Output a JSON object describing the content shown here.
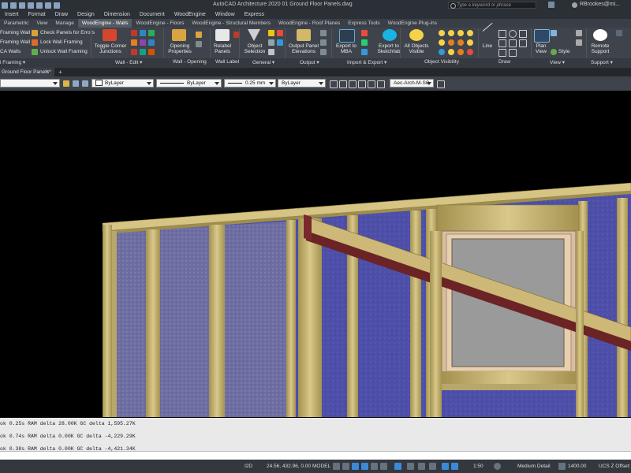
{
  "titlebar": {
    "app_title": "AutoCAD Architecture 2020   01 Ground Floor Panels.dwg",
    "search_placeholder": "Type a keyword or phrase",
    "user": "RBrookes@mi..."
  },
  "menu": [
    "Insert",
    "Format",
    "Draw",
    "Design",
    "Dimension",
    "Document",
    "WoodEngine",
    "Window",
    "Express"
  ],
  "ribbon_tabs": [
    {
      "label": "Parametric",
      "active": false
    },
    {
      "label": "View",
      "active": false
    },
    {
      "label": "Manage",
      "active": false
    },
    {
      "label": "WoodEngine - Walls",
      "active": true
    },
    {
      "label": "WoodEngine - Floors",
      "active": false
    },
    {
      "label": "WoodEngine - Structural Members",
      "active": false
    },
    {
      "label": "WoodEngine - Roof Planes",
      "active": false
    },
    {
      "label": "Express Tools",
      "active": false
    },
    {
      "label": "WoodEngine Plug-ins",
      "active": false
    }
  ],
  "ribbon": {
    "framing_wall": "Framing Wall",
    "framing_wall_2": "Framing Wall",
    "ca_walls": "CA Walls",
    "wall_framing_dd": "l Framing",
    "check_panels": "Check Panels for Errors",
    "lock_wall": "Lock Wall Framing",
    "unlock_wall": "Unlock Wall Framing",
    "toggle_corner_1": "Toggle Corner",
    "toggle_corner_2": "Junctions",
    "opening_1": "Opening",
    "opening_2": "Properties",
    "relabel_1": "Relabel",
    "relabel_2": "Panels",
    "object_sel_1": "Object",
    "object_sel_2": "Selection",
    "output_panel_1": "Output Panel",
    "output_panel_2": "Elevations",
    "export_mba_1": "Export to",
    "export_mba_2": "MBA",
    "export_sf_1": "Export to",
    "export_sf_2": "Sketchfab",
    "all_objects_1": "All Objects",
    "all_objects_2": "Visible",
    "line": "Line",
    "plan_view_1": "Plan",
    "plan_view_2": "View",
    "style": "Style",
    "remote_1": "Remote",
    "remote_2": "Support"
  },
  "ribbon_groups": {
    "wall_edit": "Wall - Edit",
    "wall_opening": "Wall - Opening",
    "wall_label": "Wall Label",
    "general": "General",
    "output": "Output",
    "import_export": "Import & Export",
    "object_visibility": "Object Visibility",
    "draw": "Draw",
    "view": "View",
    "support": "Support"
  },
  "doc_tab": {
    "label": "Ground Floor Panels*",
    "close": "×",
    "plus": "+"
  },
  "propbar": {
    "layer": "ByLayer",
    "linetype": "ByLayer",
    "lineweight": "0.25 mm",
    "plotstyle": "ByLayer",
    "layer_key": "Aec-Arch-M-SC"
  },
  "command_history": [
    "ok 0.25s RAM delta 28.00K GC delta 1,595.27K",
    "ok 0.74s RAM delta 0.00K GC delta -4,229.29K",
    "ok 0.38s RAM delta 0.00K GC delta -4,421.34K"
  ],
  "statusbar": {
    "mode": "I2D",
    "coords": "24.56, 432.96, 0.00",
    "space": "MODEL",
    "scale": "1:50",
    "detail": "Medium Detail",
    "elevation": "1400.00",
    "ucs": "UCS Z Offset:"
  },
  "colors": {
    "insulation": "#4d4fa8",
    "stud": "#c9b77a",
    "beam_red": "#6b2326",
    "window_glass": "#9a9a9a",
    "window_frame": "#e7cfb0"
  }
}
